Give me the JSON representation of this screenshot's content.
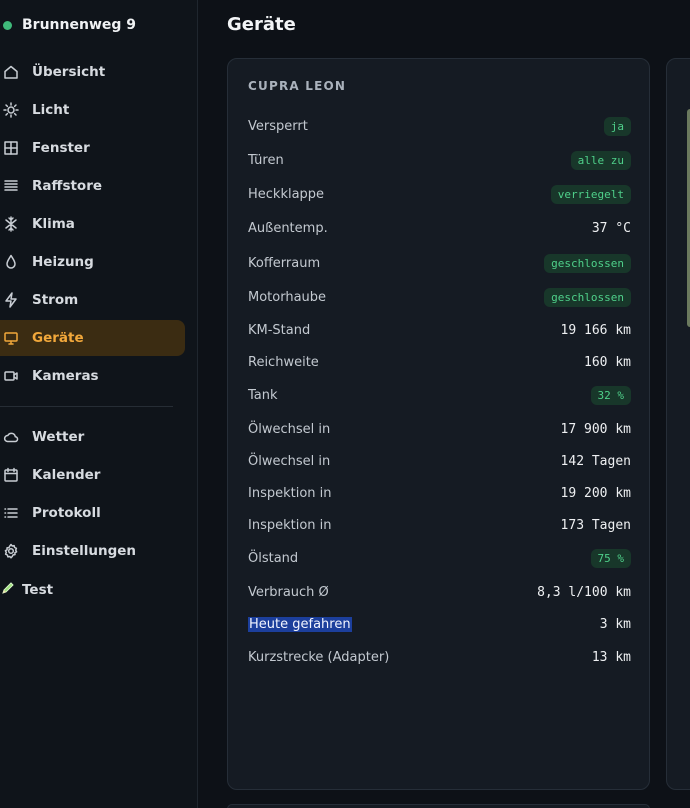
{
  "brand": {
    "name": "Brunnenweg 9",
    "status_color": "#3fb97a"
  },
  "nav": [
    {
      "id": "uebersicht",
      "label": "Übersicht",
      "icon": "home-icon",
      "active": false
    },
    {
      "id": "licht",
      "label": "Licht",
      "icon": "sun-icon",
      "active": false
    },
    {
      "id": "fenster",
      "label": "Fenster",
      "icon": "window-icon",
      "active": false
    },
    {
      "id": "raffstore",
      "label": "Raffstore",
      "icon": "blinds-icon",
      "active": false
    },
    {
      "id": "klima",
      "label": "Klima",
      "icon": "snowflake-icon",
      "active": false
    },
    {
      "id": "heizung",
      "label": "Heizung",
      "icon": "drop-icon",
      "active": false
    },
    {
      "id": "strom",
      "label": "Strom",
      "icon": "bolt-icon",
      "active": false
    },
    {
      "id": "geraete",
      "label": "Geräte",
      "icon": "monitor-icon",
      "active": true
    },
    {
      "id": "kameras",
      "label": "Kameras",
      "icon": "camera-icon",
      "active": false
    }
  ],
  "nav_secondary": [
    {
      "id": "wetter",
      "label": "Wetter",
      "icon": "cloud-icon"
    },
    {
      "id": "kalender",
      "label": "Kalender",
      "icon": "calendar-icon"
    },
    {
      "id": "protokoll",
      "label": "Protokoll",
      "icon": "list-icon"
    },
    {
      "id": "einstellungen",
      "label": "Einstellungen",
      "icon": "gear-icon"
    }
  ],
  "test_item": {
    "label": "Test",
    "icon": "pencil-icon"
  },
  "page": {
    "title": "Geräte"
  },
  "card": {
    "title": "CUPRA LEON",
    "rows": [
      {
        "key": "Versperrt",
        "value": "ja",
        "badge": true
      },
      {
        "key": "Türen",
        "value": "alle zu",
        "badge": true
      },
      {
        "key": "Heckklappe",
        "value": "verriegelt",
        "badge": true
      },
      {
        "key": "Außentemp.",
        "value": "37 °C",
        "badge": false
      },
      {
        "key": "Kofferraum",
        "value": "geschlossen",
        "badge": true
      },
      {
        "key": "Motorhaube",
        "value": "geschlossen",
        "badge": true
      },
      {
        "key": "KM-Stand",
        "value": "19 166 km",
        "badge": false
      },
      {
        "key": "Reichweite",
        "value": "160 km",
        "badge": false
      },
      {
        "key": "Tank",
        "value": "32 %",
        "badge": true
      },
      {
        "key": "Ölwechsel in",
        "value": "17 900 km",
        "badge": false
      },
      {
        "key": "Ölwechsel in",
        "value": "142 Tagen",
        "badge": false
      },
      {
        "key": "Inspektion in",
        "value": "19 200 km",
        "badge": false
      },
      {
        "key": "Inspektion in",
        "value": "173 Tagen",
        "badge": false
      },
      {
        "key": "Ölstand",
        "value": "75 %",
        "badge": true
      },
      {
        "key": "Verbrauch Ø",
        "value": "8,3 l/100 km",
        "badge": false
      },
      {
        "key": "Heute gefahren",
        "value": "3 km",
        "badge": false,
        "selected": true
      },
      {
        "key": "Kurzstrecke (Adapter)",
        "value": "13 km",
        "badge": false
      }
    ]
  },
  "colors": {
    "accent": "#f2a83b",
    "badge_text": "#4fd08a",
    "badge_bg": "#18372a",
    "selection": "#1c3f9c"
  }
}
